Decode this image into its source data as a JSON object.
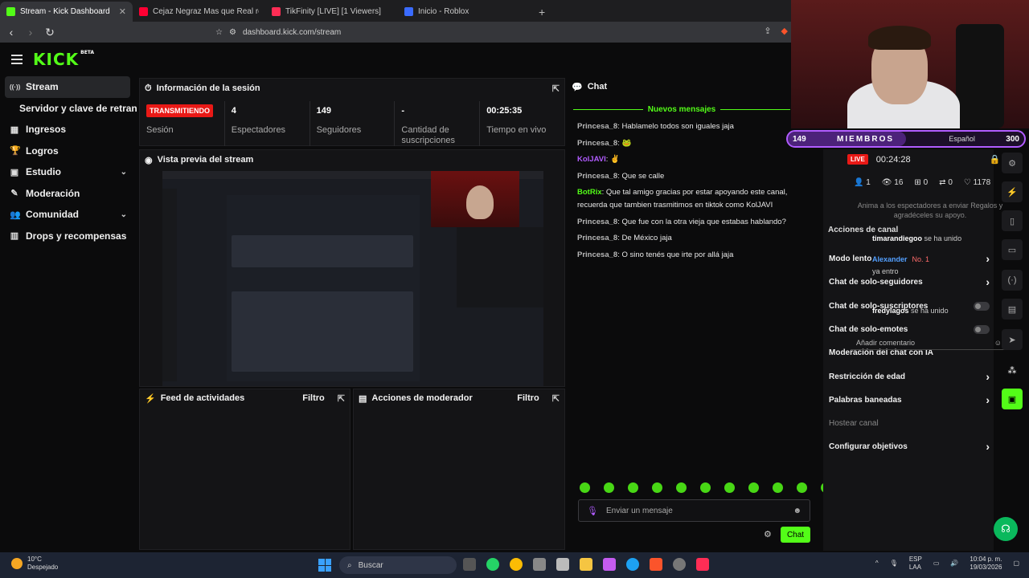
{
  "browser": {
    "tabs": [
      {
        "title": "Stream - Kick Dashboard",
        "color": "#53fc18",
        "active": true
      },
      {
        "title": "Cejaz Negraz Mas que Real rolling M",
        "color": "#ff0033"
      },
      {
        "title": "TikFinity [LIVE] [1 Viewers]",
        "color": "#ff2d55"
      },
      {
        "title": "Inicio - Roblox",
        "color": "#3a6bff"
      }
    ],
    "new_tab": "+",
    "url": "dashboard.kick.com/stream"
  },
  "header": {
    "logo": "KICK",
    "logo_sup": "BETA"
  },
  "sidebar": {
    "items": [
      {
        "label": "Stream",
        "icon": "broadcast-icon",
        "glyph": "((·))"
      },
      {
        "label": "Servidor y clave de retransmisión",
        "sub": true
      },
      {
        "label": "Ingresos",
        "icon": "revenue-icon",
        "glyph": "▦"
      },
      {
        "label": "Logros",
        "icon": "trophy-icon",
        "glyph": "🏆"
      },
      {
        "label": "Estudio",
        "icon": "studio-icon",
        "glyph": "▣",
        "chevron": "⌄"
      },
      {
        "label": "Moderación",
        "icon": "wrench-icon",
        "glyph": "✎"
      },
      {
        "label": "Comunidad",
        "icon": "community-icon",
        "glyph": "👥",
        "chevron": "⌄"
      },
      {
        "label": "Drops y recompensas",
        "icon": "drops-icon",
        "glyph": "▥"
      }
    ]
  },
  "session": {
    "title": "Información de la sesión",
    "status_badge": "TRANSMITIENDO",
    "status_label": "Sesión",
    "stats": [
      {
        "value": "4",
        "label": "Espectadores"
      },
      {
        "value": "149",
        "label": "Seguidores"
      },
      {
        "value": "-",
        "label": "Cantidad de suscripciones"
      },
      {
        "value": "00:25:35",
        "label": "Tiempo en vivo"
      }
    ]
  },
  "preview": {
    "title": "Vista previa del stream"
  },
  "activity": {
    "title": "Feed de actividades",
    "filter": "Filtro"
  },
  "modactions": {
    "title": "Acciones de moderador",
    "filter": "Filtro"
  },
  "chat": {
    "title": "Chat",
    "new_messages": "Nuevos mensajes",
    "messages": [
      {
        "user": "Princesa_8",
        "text": "Hablamelo todos son iguales jaja",
        "cls": ""
      },
      {
        "user": "Princesa_8",
        "text": "🐸",
        "cls": ""
      },
      {
        "user": "KolJAVI",
        "text": "✌",
        "cls": "p"
      },
      {
        "user": "Princesa_8",
        "text": "Que se calle",
        "cls": ""
      },
      {
        "user": "BotRix",
        "text": "Que tal amigo gracias por estar apoyando este canal, recuerda que tambien trasmitimos en tiktok como KolJAVI",
        "cls": "g"
      },
      {
        "user": "Princesa_8",
        "text": "Que fue con la otra vieja que estabas hablando?",
        "cls": ""
      },
      {
        "user": "Princesa_8",
        "text": "De México jaja",
        "cls": ""
      },
      {
        "user": "Princesa_8",
        "text": "O sino tenés que irte por allá jaja",
        "cls": ""
      }
    ],
    "input_placeholder": "Enviar un mensaje",
    "send_label": "Chat"
  },
  "overlay": {
    "members_left": "149",
    "members_title": "MIEMBROS",
    "members_right": "300",
    "members_progress": 0.5,
    "members_subtitle": "Español",
    "live_badge": "LIVE",
    "live_time": "00:24:28",
    "counts": [
      "1",
      "16",
      "0",
      "0",
      "1178"
    ],
    "hint": "Anima a los espectadores a enviar Regalos y agradéceles su apoyo.",
    "actions_title": "Acciones de canal",
    "actions": [
      {
        "label": "Modo lento",
        "type": "chevron"
      },
      {
        "label": "Chat de solo-seguidores",
        "type": "chevron"
      },
      {
        "label": "Chat de solo-suscriptores",
        "type": "toggle"
      },
      {
        "label": "Chat de solo-emotes",
        "type": "toggle"
      },
      {
        "label": "Moderación del chat con IA",
        "type": "none"
      },
      {
        "label": "Restricción de edad",
        "type": "chevron"
      },
      {
        "label": "Palabras baneadas",
        "type": "chevron"
      },
      {
        "label": "Hostear canal",
        "type": "dim"
      },
      {
        "label": "Configurar objetivos",
        "type": "chevron"
      }
    ],
    "events": [
      {
        "user": "timarandiegoo",
        "text": "se ha unido"
      },
      {
        "user": "Alexander",
        "badge": "No. 1",
        "text": "ya entro"
      },
      {
        "user": "fredylagos",
        "text": "se ha unido"
      }
    ],
    "comment_placeholder": "Añadir comentario"
  },
  "taskbar": {
    "temp": "10°C",
    "weather": "Despejado",
    "search": "Buscar",
    "lang": "ESP",
    "lang2": "LAA",
    "time": "10:04 p. m.",
    "date": "19/03/2026",
    "notif_count": "17"
  }
}
